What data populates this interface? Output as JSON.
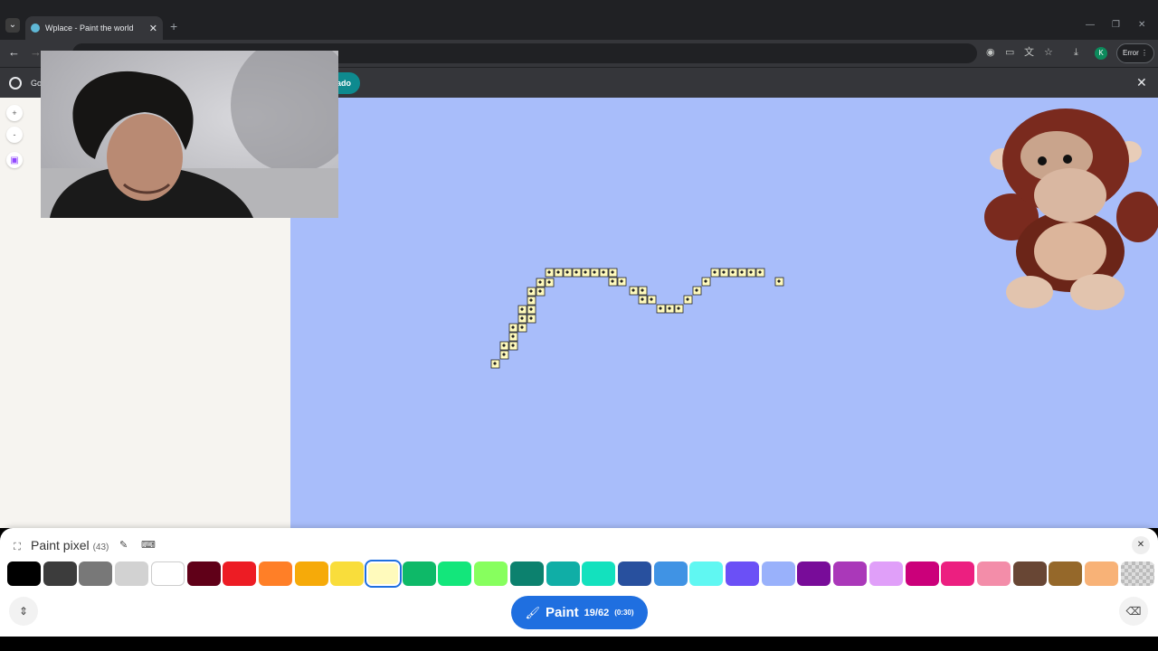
{
  "browser": {
    "tab_title": "Wplace - Paint the world",
    "new_tab": "+",
    "error_label": "Error",
    "profile_initial": "K"
  },
  "infobar": {
    "text": "Go",
    "button_label": "ado"
  },
  "map": {
    "zoom_in": "+",
    "zoom_out": "-"
  },
  "panel": {
    "title": "Paint pixel",
    "count": "(43)",
    "paint_label": "Paint",
    "charges": "19/62",
    "timer": "(0:30)",
    "selected_color_index": 10,
    "colors": [
      "#000000",
      "#3c3c3c",
      "#787878",
      "#d2d2d2",
      "#ffffff",
      "#600018",
      "#ed1c24",
      "#ff7f27",
      "#f6aa09",
      "#f9dd3b",
      "#fffabc",
      "#0eb968",
      "#13e67b",
      "#87ff5e",
      "#0c816e",
      "#10aea6",
      "#13e1be",
      "#28509e",
      "#4093e4",
      "#60f7f2",
      "#6b50f6",
      "#99b1fb",
      "#780c99",
      "#aa38b9",
      "#e09ff9",
      "#cb007a",
      "#ec1f80",
      "#f38da9",
      "#684634",
      "#95682a",
      "#f8b277",
      "transparent"
    ]
  },
  "pixel_trail": {
    "color": "#fffabc",
    "cells": [
      [
        547,
        402
      ],
      [
        557,
        392
      ],
      [
        557,
        382
      ],
      [
        567,
        382
      ],
      [
        567,
        372
      ],
      [
        567,
        362
      ],
      [
        577,
        362
      ],
      [
        577,
        352
      ],
      [
        587,
        352
      ],
      [
        577,
        342
      ],
      [
        587,
        342
      ],
      [
        587,
        332
      ],
      [
        587,
        322
      ],
      [
        597,
        322
      ],
      [
        597,
        312
      ],
      [
        607,
        312
      ],
      [
        607,
        301
      ],
      [
        617,
        301
      ],
      [
        627,
        301
      ],
      [
        637,
        301
      ],
      [
        647,
        301
      ],
      [
        657,
        301
      ],
      [
        667,
        301
      ],
      [
        677,
        301
      ],
      [
        677,
        311
      ],
      [
        687,
        311
      ],
      [
        700,
        321
      ],
      [
        710,
        321
      ],
      [
        710,
        331
      ],
      [
        720,
        331
      ],
      [
        730,
        341
      ],
      [
        740,
        341
      ],
      [
        750,
        341
      ],
      [
        760,
        331
      ],
      [
        770,
        321
      ],
      [
        780,
        311
      ],
      [
        790,
        301
      ],
      [
        800,
        301
      ],
      [
        810,
        301
      ],
      [
        820,
        301
      ],
      [
        830,
        301
      ],
      [
        840,
        301
      ],
      [
        861,
        311
      ]
    ]
  }
}
